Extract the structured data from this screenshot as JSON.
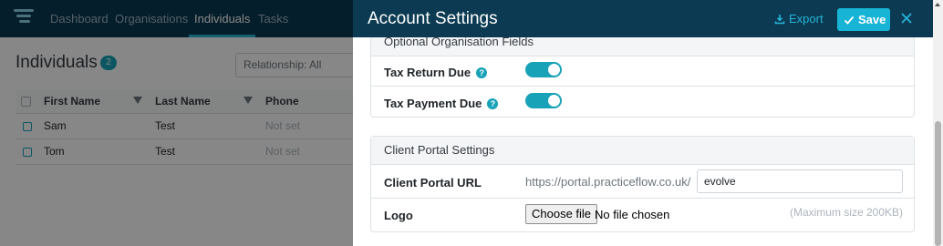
{
  "background": {
    "nav": [
      "Dashboard",
      "Organisations",
      "Individuals",
      "Tasks"
    ],
    "page_title": "Individuals",
    "count": "2",
    "relationship_select": "Relationship: All",
    "table": {
      "columns": [
        "First Name",
        "Last Name",
        "Phone"
      ],
      "rows": [
        {
          "first": "Sam",
          "last": "Test",
          "phone": "Not set"
        },
        {
          "first": "Tom",
          "last": "Test",
          "phone": "Not set"
        }
      ]
    }
  },
  "panel": {
    "title": "Account Settings",
    "export_label": "Export",
    "save_label": "Save",
    "optional_fields": {
      "heading": "Optional Organisation Fields",
      "rows": [
        {
          "label": "Tax Return Due",
          "enabled": true
        },
        {
          "label": "Tax Payment Due",
          "enabled": true
        }
      ]
    },
    "client_portal": {
      "heading": "Client Portal Settings",
      "url_label": "Client Portal URL",
      "url_prefix": "https://portal.practiceflow.co.uk/",
      "url_value": "evolve",
      "logo_label": "Logo",
      "choose_file": "Choose file",
      "no_file": "No file chosen",
      "max_size": "(Maximum size 200KB)"
    }
  },
  "colors": {
    "header": "#0b3a52",
    "accent": "#17b4d6",
    "toggle_on": "#17a2b8"
  },
  "help_icon_glyph": "?"
}
